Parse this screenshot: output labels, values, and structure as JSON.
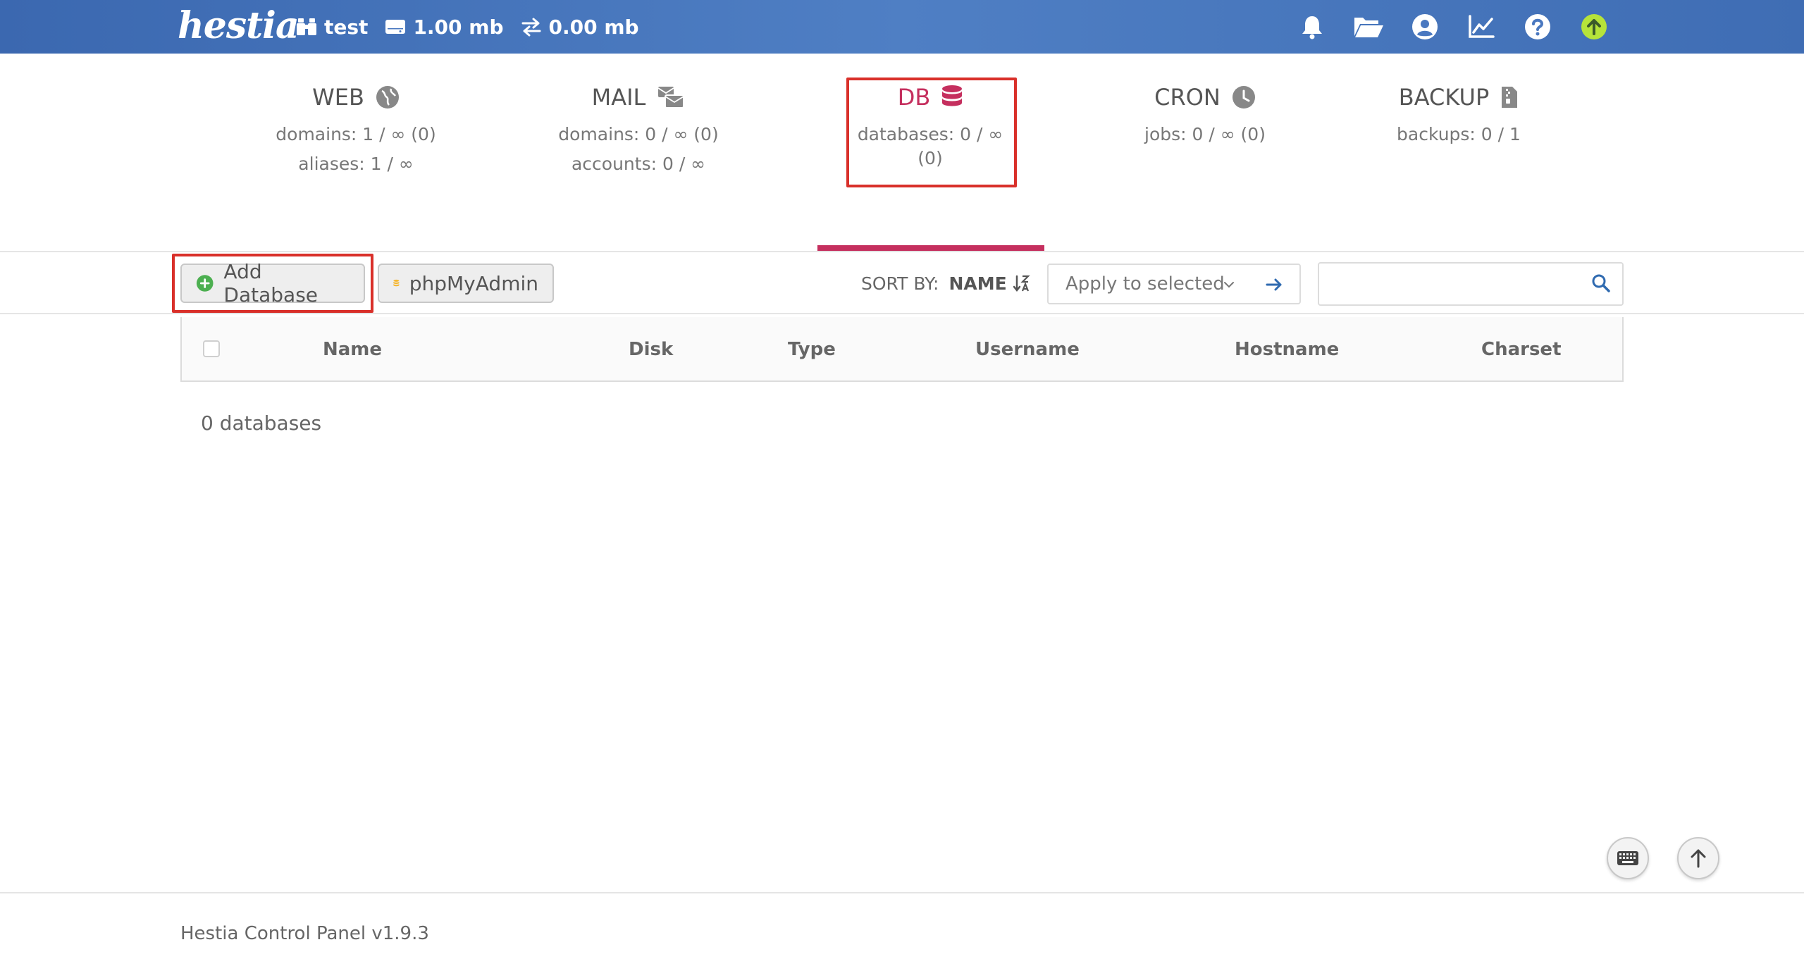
{
  "topbar": {
    "logo": "hestia",
    "user": "test",
    "disk": "1.00 mb",
    "bandwidth": "0.00 mb"
  },
  "panels": {
    "web": {
      "title": "WEB",
      "line1": "domains: 1 / ∞ (0)",
      "line2": "aliases: 1 / ∞"
    },
    "mail": {
      "title": "MAIL",
      "line1": "domains: 0 / ∞ (0)",
      "line2": "accounts: 0 / ∞"
    },
    "db": {
      "title": "DB",
      "line1": "databases: 0 / ∞ (0)"
    },
    "cron": {
      "title": "CRON",
      "line1": "jobs: 0 / ∞ (0)"
    },
    "backup": {
      "title": "BACKUP",
      "line1": "backups: 0 / 1"
    }
  },
  "toolbar": {
    "add_label": "Add Database",
    "phpmyadmin_label": "phpMyAdmin",
    "sort_label": "SORT BY:",
    "sort_value": "NAME",
    "apply_label": "Apply to selected",
    "search_placeholder": ""
  },
  "table": {
    "columns": [
      "Name",
      "Disk",
      "Type",
      "Username",
      "Hostname",
      "Charset"
    ]
  },
  "count_text": "0 databases",
  "footer": {
    "text": "Hestia Control Panel v1.9.3"
  },
  "colors": {
    "accent": "#c52f5e",
    "topbar": "#4a78c0",
    "highlight": "#d9302a",
    "add_icon": "#4caf50",
    "phpmyadmin_icon": "#f5b731",
    "update_icon": "#b6e33a"
  }
}
